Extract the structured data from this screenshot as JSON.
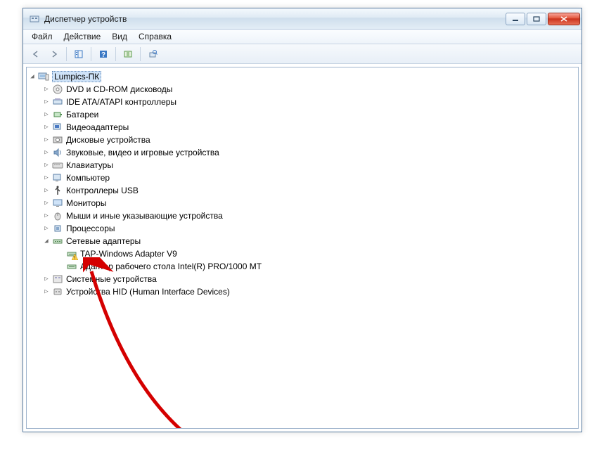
{
  "window": {
    "title": "Диспетчер устройств"
  },
  "menu": {
    "file": "Файл",
    "action": "Действие",
    "view": "Вид",
    "help": "Справка"
  },
  "tree": {
    "root": "Lumpics-ПК",
    "items": [
      "DVD и CD-ROM дисководы",
      "IDE ATA/ATAPI контроллеры",
      "Батареи",
      "Видеоадаптеры",
      "Дисковые устройства",
      "Звуковые, видео и игровые устройства",
      "Клавиатуры",
      "Компьютер",
      "Контроллеры USB",
      "Мониторы",
      "Мыши и иные указывающие устройства",
      "Процессоры",
      "Сетевые адаптеры",
      "Системные устройства",
      "Устройства HID (Human Interface Devices)"
    ],
    "network_children": [
      "TAP-Windows Adapter V9",
      "Адаптер рабочего стола Intel(R) PRO/1000 MT"
    ]
  }
}
